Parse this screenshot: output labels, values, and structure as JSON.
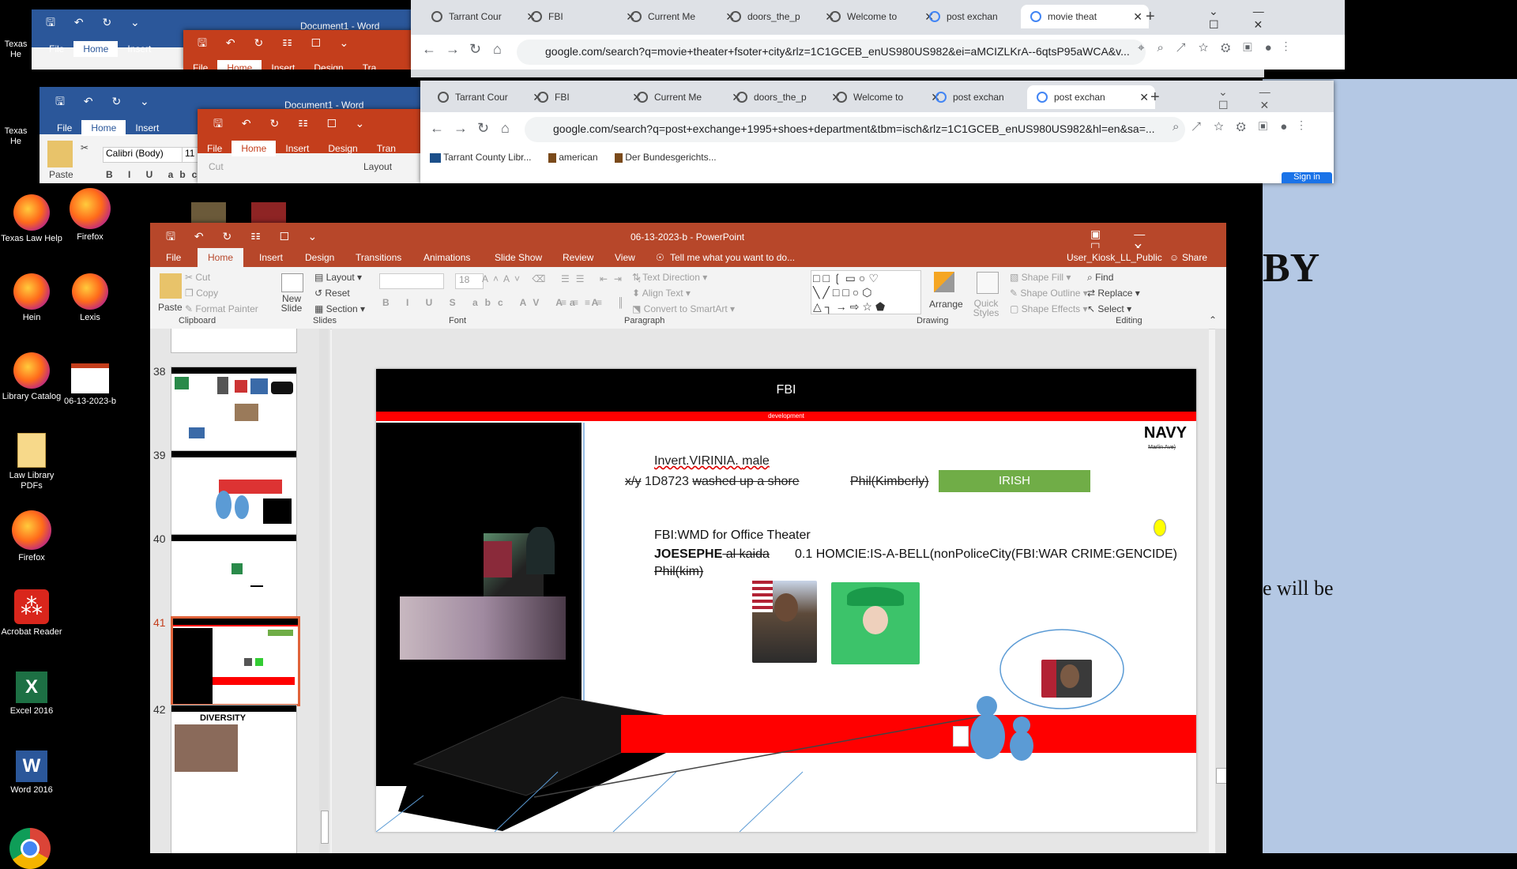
{
  "desktop": {
    "icons": [
      {
        "label": "Texas Law Help"
      },
      {
        "label": "Firefox"
      },
      {
        "label": "Hein"
      },
      {
        "label": "Lexis"
      },
      {
        "label": "Library Catalog"
      },
      {
        "label": "06-13-2023-b"
      },
      {
        "label": "Law Library PDFs"
      },
      {
        "label": "Firefox"
      },
      {
        "label": "Acrobat Reader"
      },
      {
        "label": "Excel 2016"
      },
      {
        "label": "Word 2016"
      }
    ],
    "partial_labels": {
      "top1": "Texas",
      "top2": "He",
      "top3": "Texas",
      "top4": "He"
    }
  },
  "background_doc": {
    "big_text": "BY",
    "line_text": "e will be"
  },
  "word1": {
    "title": "Document1 - Word",
    "tabs": [
      "File",
      "Home",
      "Insert"
    ],
    "active_tab": "Home"
  },
  "ppt_bg1": {
    "tabs": [
      "File",
      "Home",
      "Insert",
      "Design",
      "Tra"
    ]
  },
  "word2": {
    "title": "Document1 - Word",
    "tabs": [
      "File",
      "Home",
      "Insert"
    ],
    "paste": "Paste",
    "font": "Calibri (Body)",
    "size": "11",
    "cut": "Cut"
  },
  "ppt_bg2": {
    "tabs": [
      "File",
      "Home",
      "Insert",
      "Design",
      "Tran"
    ],
    "layout": "Layout"
  },
  "chrome1": {
    "tabs": [
      "Tarrant Cour",
      "FBI",
      "Current Me",
      "doors_the_p",
      "Welcome to",
      "post exchan",
      "movie theat"
    ],
    "url": "google.com/search?q=movie+theater+fsoter+city&rlz=1C1GCEB_enUS980US982&ei=aMCIZLKrA--6qtsP95aWCA&v..."
  },
  "chrome2": {
    "tabs": [
      "Tarrant Cour",
      "FBI",
      "Current Me",
      "doors_the_p",
      "Welcome to",
      "post exchan",
      "post exchan"
    ],
    "url": "google.com/search?q=post+exchange+1995+shoes+department&tbm=isch&rlz=1C1GCEB_enUS980US982&hl=en&sa=...",
    "bookmarks": [
      "Tarrant County Libr...",
      "american",
      "Der Bundesgerichts..."
    ],
    "signin": "Sign in"
  },
  "ppt": {
    "title": "06-13-2023-b - PowerPoint",
    "tabs": [
      "File",
      "Home",
      "Insert",
      "Design",
      "Transitions",
      "Animations",
      "Slide Show",
      "Review",
      "View"
    ],
    "tell_me": "Tell me what you want to do...",
    "user": "User_Kiosk_LL_Public",
    "share": "Share",
    "ribbon": {
      "paste": "Paste",
      "cut": "Cut",
      "copy": "Copy",
      "format_painter": "Format Painter",
      "new_slide": "New Slide",
      "layout": "Layout",
      "reset": "Reset",
      "section": "Section",
      "font_size": "18",
      "text_direction": "Text Direction",
      "align_text": "Align Text",
      "convert": "Convert to SmartArt",
      "arrange": "Arrange",
      "quick_styles": "Quick Styles",
      "shape_fill": "Shape Fill",
      "shape_outline": "Shape Outline",
      "shape_effects": "Shape Effects",
      "find": "Find",
      "replace": "Replace",
      "select": "Select",
      "groups": [
        "Clipboard",
        "Slides",
        "Font",
        "Paragraph",
        "Drawing",
        "Editing"
      ]
    },
    "thumbs": [
      {
        "num": "38"
      },
      {
        "num": "39"
      },
      {
        "num": "40"
      },
      {
        "num": "41"
      },
      {
        "num": "42"
      }
    ],
    "thumb42_title": "DIVERSITY",
    "slide": {
      "header": "FBI",
      "subheader": "development",
      "navy": "NAVY",
      "navy_sub": "Marlin Ave)",
      "line1_a": "Invert.VIRINIA. ",
      "line1_b": "male",
      "line2_a": "x/y",
      "line2_b": " 1D8723 ",
      "line2_c": "washed up a shore",
      "phil_kimberly": "Phil(Kimberly)",
      "irish": "IRISH",
      "wmd": "FBI:WMD for Office Theater",
      "joesephe": "JOESEPHE",
      "al_kaida": " al kaida ",
      "homcie": "0.1 HOMCIE:IS-A-BELL(nonPoliceCity(FBI:WAR CRIME:GENCIDE)",
      "phil_kim": "Phil(kim)"
    }
  },
  "colors": {
    "ppt_red": "#b7472a",
    "word_blue": "#2b579a",
    "irish_green": "#70ad47",
    "slide_red": "#ff0000"
  }
}
